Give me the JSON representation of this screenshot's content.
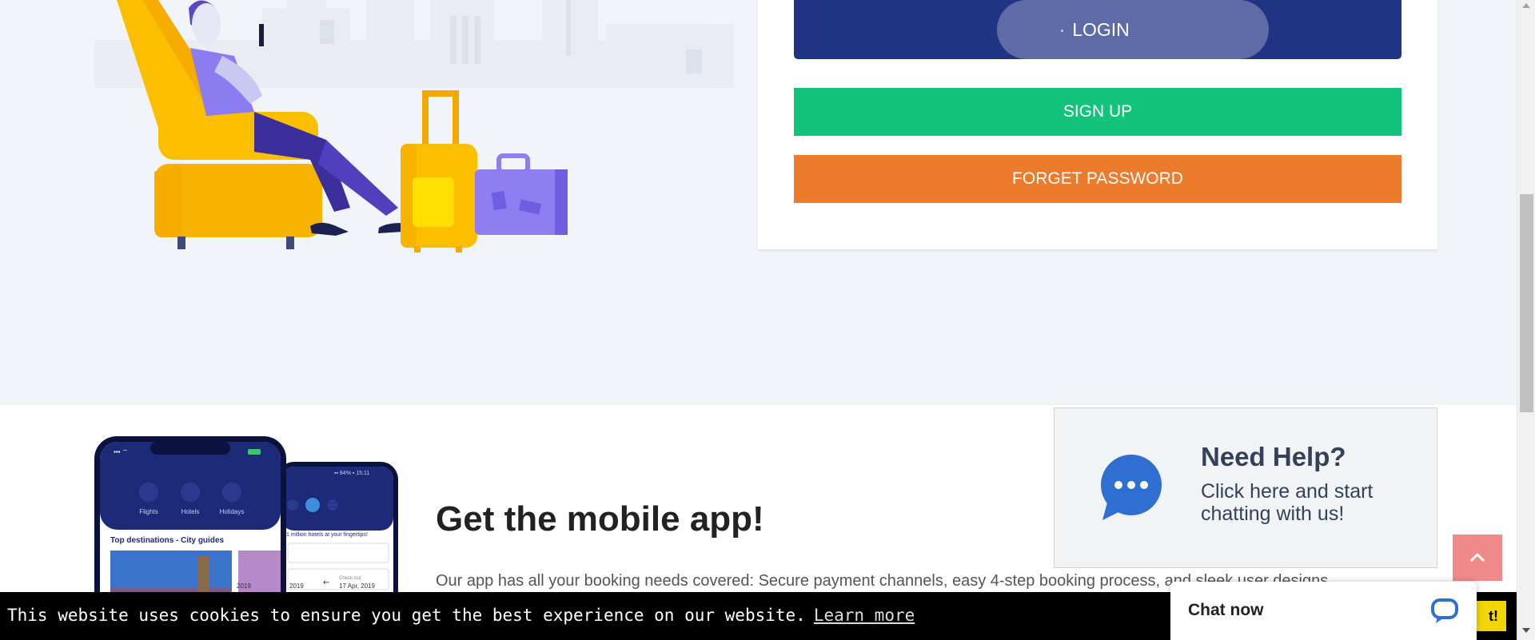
{
  "login_card": {
    "login_label": "LOGIN",
    "signup_label": "SIGN UP",
    "forget_label": "FORGET PASSWORD"
  },
  "app_section": {
    "title": "Get the mobile app!",
    "description": "Our app has all your booking needs covered: Secure payment channels, easy 4-step booking process, and sleek user designs",
    "phone_front": {
      "tabs": [
        "Flights",
        "Hotels",
        "Holidays"
      ],
      "heading": "Top destinations - City guides",
      "date_partial": "2019"
    },
    "phone_back": {
      "tagline": "1 million hotels at your fingertips!",
      "check_out_label": "Check-out",
      "check_out_date": "17 Apr, 2019",
      "date_partial": "2019"
    }
  },
  "help_widget": {
    "title": "Need Help?",
    "text": "Click here and start chatting with us!"
  },
  "cookie_bar": {
    "message": "This website uses cookies to ensure you get the best experience on our website.",
    "learn_more": "Learn more",
    "accept_partial": "t!"
  },
  "chat": {
    "label": "Chat now"
  },
  "colors": {
    "login": "#213384",
    "signup": "#12c37c",
    "forget": "#ec7b2c",
    "page_bg": "#f1f4f9",
    "scroll_top": "#ef8a8a",
    "cookie_accept": "#f1d600"
  },
  "icons": {
    "help": "chat-bubble-icon",
    "chat": "speech-bubble-icon",
    "scroll_top": "chevron-up-icon"
  }
}
